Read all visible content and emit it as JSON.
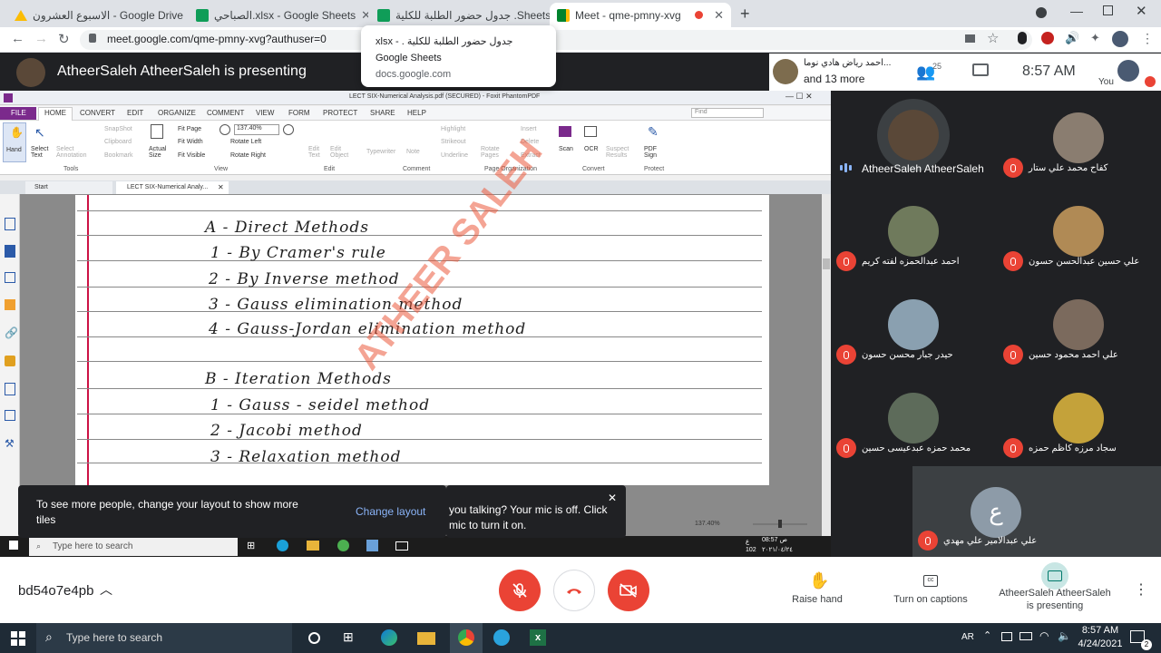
{
  "browser": {
    "tabs": [
      {
        "label": "الاسبوع العشرون - Google Drive",
        "icon": "google-drive-icon"
      },
      {
        "label": "الصباحي.xlsx - Google Sheets",
        "icon": "google-sheets-icon"
      },
      {
        "label": "جدول حضور الطلبة للكلية .Sheets",
        "icon": "google-sheets-icon"
      },
      {
        "label": "Meet - qme-pmny-xvg",
        "icon": "google-meet-icon"
      }
    ],
    "url": "meet.google.com/qme-pmny-xvg?authuser=0",
    "tooltip": {
      "title": "جدول حضور الطلبة للكلية . - xlsx",
      "subtitle": "Google Sheets",
      "domain": "docs.google.com"
    }
  },
  "meet": {
    "presenting_title": "AtheerSaleh AtheerSaleh is presenting",
    "other_participant": "احمد رياض هادي نوما...",
    "more": "and 13 more",
    "participant_count": "25",
    "time": "8:57 AM",
    "you_label": "You",
    "meeting_code": "bd54o7e4pb",
    "controls": {
      "raise_hand": "Raise hand",
      "captions": "Turn on captions",
      "presenting_line1": "AtheerSaleh AtheerSaleh",
      "presenting_line2": "is presenting"
    },
    "toast_layout": {
      "text": "To see more people, change your layout to show more tiles",
      "action": "Change layout"
    },
    "toast_mic": {
      "text": "you talking? Your mic is off. Click mic to turn it on."
    },
    "presenter_name": "AtheerSaleh AtheerSaleh",
    "participants": [
      {
        "name": "كفاح محمد علي ستار",
        "color": "#8a7d70"
      },
      {
        "name": "احمد عبدالحمزه لفته كريم",
        "color": "#6f7a5c"
      },
      {
        "name": "علي حسين عبدالحسن حسون",
        "color": "#b08a55"
      },
      {
        "name": "حيدر جبار محسن حسون",
        "color": "#8aa0b0"
      },
      {
        "name": "علي احمد محمود حسين",
        "color": "#7b6a5d"
      },
      {
        "name": "محمد حمزه عبدعيسى حسين",
        "color": "#5d6b5a"
      },
      {
        "name": "سجاد مرزه كاظم حمزه",
        "color": "#c4a23a"
      }
    ],
    "last_participant": {
      "name": "علي عبدالامير علي مهدي",
      "initial": "ع"
    }
  },
  "pdf_app": {
    "title": "LECT SIX-Numerical Analysis.pdf (SECURED) - Foxit PhantomPDF",
    "menu": [
      "FILE",
      "HOME",
      "CONVERT",
      "EDIT",
      "ORGANIZE",
      "COMMENT",
      "VIEW",
      "FORM",
      "PROTECT",
      "SHARE",
      "HELP"
    ],
    "search_placeholder": "Find",
    "zoom": "137.40%",
    "doc_tabs": [
      "Start",
      "LECT SIX-Numerical Analy..."
    ],
    "ribbon": {
      "hand": "Hand",
      "select_text": "Select Text",
      "select_annotation": "Select Annotation",
      "snapshot": "SnapShot",
      "clipboard": "Clipboard",
      "bookmark": "Bookmark",
      "actual_size": "Actual Size",
      "fit_page": "Fit Page",
      "fit_width": "Fit Width",
      "fit_visible": "Fit Visible",
      "rotate_left": "Rotate Left",
      "rotate_right": "Rotate Right",
      "edit_text": "Edit Text",
      "edit_object": "Edit Object",
      "typewriter": "Typewriter",
      "note": "Note",
      "highlight": "Highlight",
      "strikeout": "Strikeout",
      "underline": "Underline",
      "rotate_pages": "Rotate Pages",
      "insert": "Insert",
      "delete": "Delete",
      "extract": "Extract",
      "scan": "Scan",
      "ocr": "OCR",
      "suspect_results": "Suspect Results",
      "pdf_sign": "PDF Sign",
      "groups": [
        "Tools",
        "View",
        "Edit",
        "Comment",
        "Page Organization",
        "Convert",
        "Protect"
      ]
    },
    "status_zoom": "137.40%",
    "handwriting": [
      "A - Direct Methods",
      "1 - By Cramer's rule",
      "2 - By Inverse method",
      "3 - Gauss elimination method",
      "4 - Gauss-Jordan elimination method",
      "B - Iteration Methods",
      "1 - Gauss - seidel method",
      "2 - Jacobi method",
      "3 - Relaxation method"
    ],
    "watermark": "ATHEER SALEH"
  },
  "inner_taskbar": {
    "search": "Type here to search",
    "time": "08:57 ص",
    "date": "٢٠٢١/٠٤/٢٤",
    "lang": "ع",
    "num": "102"
  },
  "taskbar": {
    "search": "Type here to search",
    "lang": "AR",
    "time": "8:57 AM",
    "date": "4/24/2021",
    "notif": "2"
  },
  "colors": {
    "red": "#ea4335",
    "meet_dark": "#202124",
    "foxit_purple": "#7b2a8c",
    "teal": "#00897b"
  }
}
